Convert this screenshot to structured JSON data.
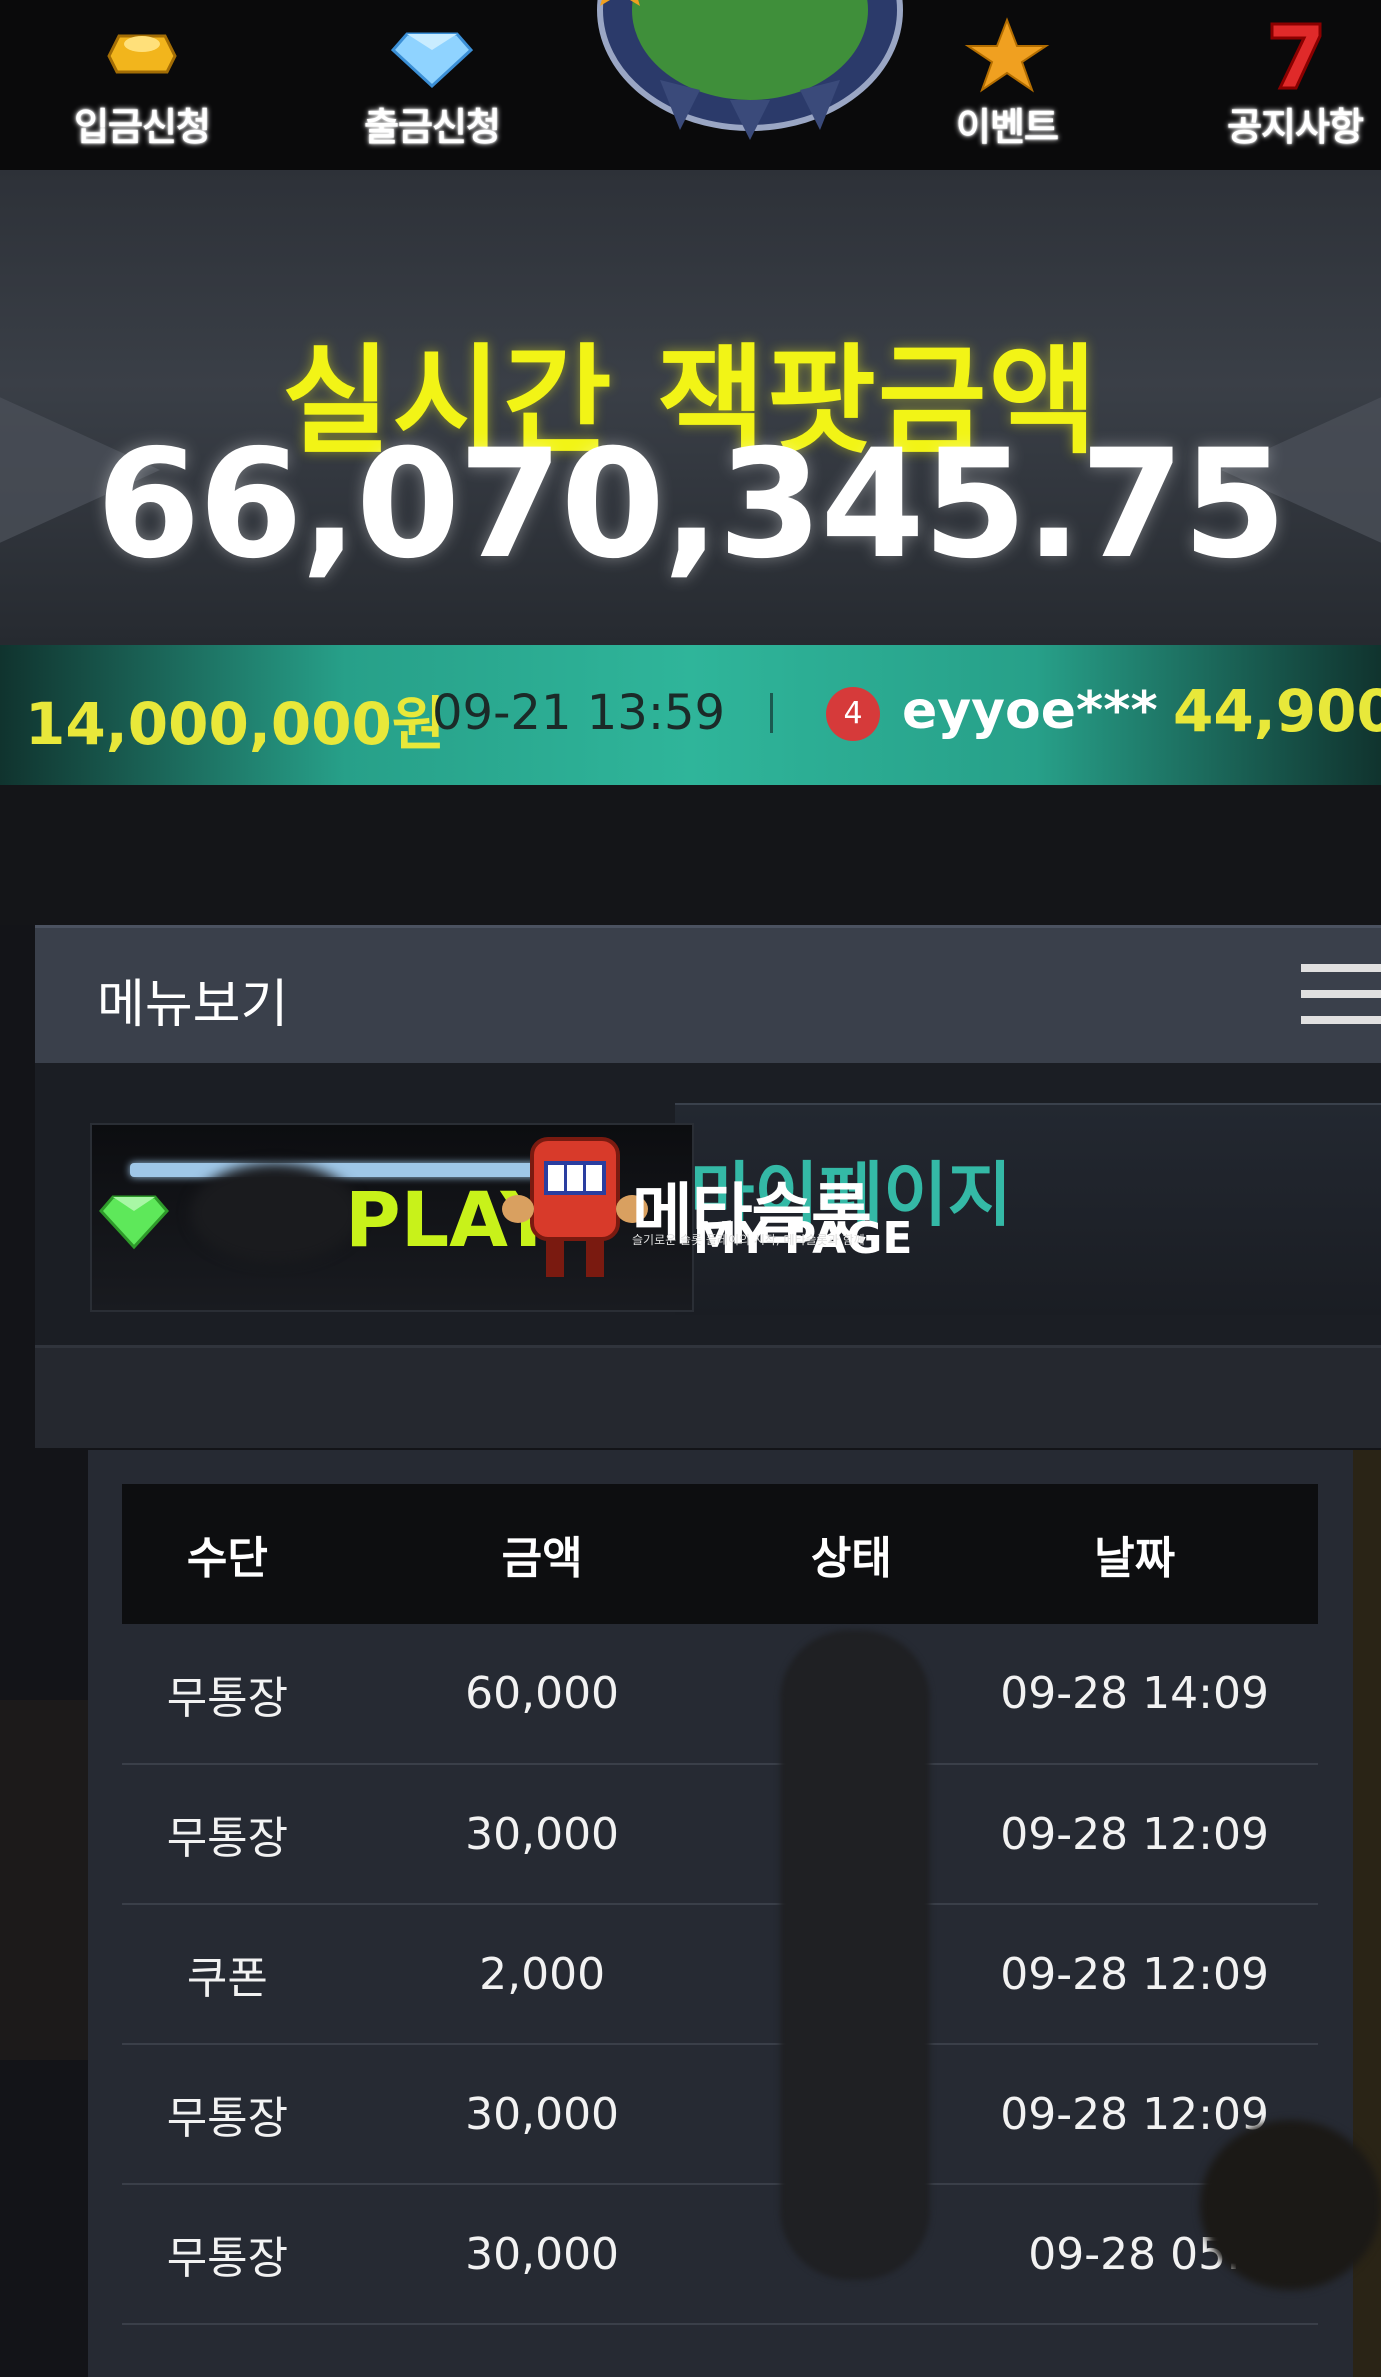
{
  "nav": {
    "items": [
      {
        "label": "입금신청",
        "icon": "gold-ingot-icon"
      },
      {
        "label": "출금신청",
        "icon": "diamond-icon"
      },
      {
        "label": "이벤트",
        "icon": "star-icon"
      },
      {
        "label": "공지사항",
        "icon": "lucky-seven-icon"
      }
    ]
  },
  "jackpot": {
    "title": "실시간 잭팟금액",
    "amount": "66,070,345.75"
  },
  "ticker": {
    "amount_left": "14,000,000원",
    "time": "09-21 13:59",
    "rank": "4",
    "user": "eyyoe***",
    "amount_right": "44,900,"
  },
  "menu": {
    "label": "메뉴보기"
  },
  "play": {
    "play_label": "PLAY",
    "brand": "메타슬롯",
    "brand_tagline": "슬기로운 슬롯 플레이의 시작, 메타슬롯과 함께",
    "page_title_ko": "마이페이지",
    "page_title_en": "MY PAGE"
  },
  "table": {
    "headers": [
      "수단",
      "금액",
      "상태",
      "날짜"
    ],
    "rows": [
      {
        "method": "무통장",
        "amount": "60,000",
        "status": "",
        "date": "09-28 14:09"
      },
      {
        "method": "무통장",
        "amount": "30,000",
        "status": "",
        "date": "09-28 12:09"
      },
      {
        "method": "쿠폰",
        "amount": "2,000",
        "status": "",
        "date": "09-28 12:09"
      },
      {
        "method": "무통장",
        "amount": "30,000",
        "status": "",
        "date": "09-28 12:09"
      },
      {
        "method": "무통장",
        "amount": "30,000",
        "status": "",
        "date": "09-28 05:"
      }
    ]
  },
  "colors": {
    "accent_yellow": "#f2f416",
    "accent_lime": "#c8f21a",
    "accent_teal": "#34b9a6",
    "ticker_bg": "#2fb59a",
    "badge_red": "#d63a3a"
  }
}
